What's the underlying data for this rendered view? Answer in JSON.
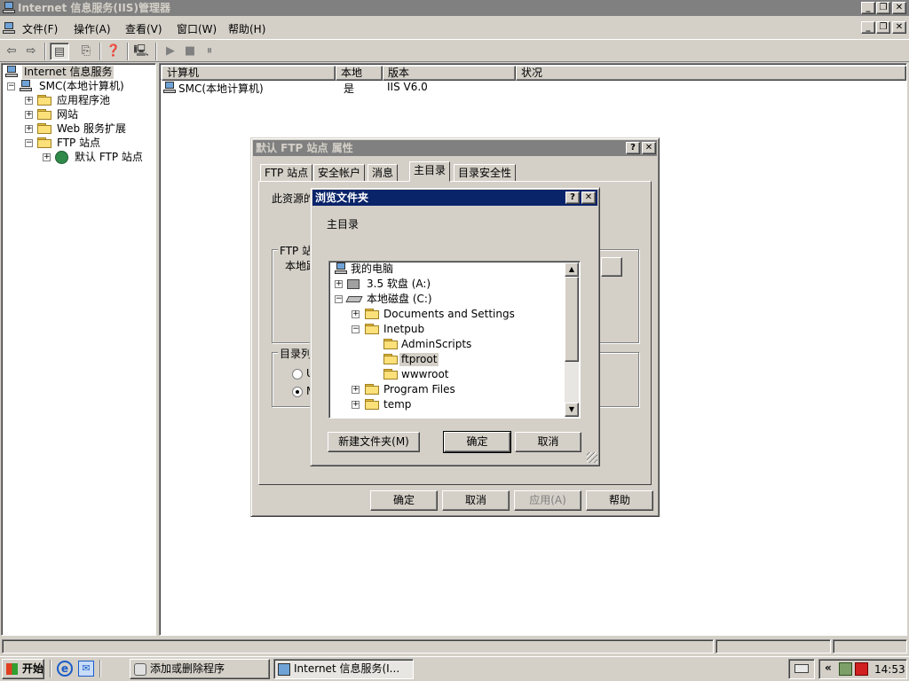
{
  "window": {
    "title": "Internet 信息服务(IIS)管理器"
  },
  "menu": {
    "items": [
      "文件(F)",
      "操作(A)",
      "查看(V)",
      "窗口(W)",
      "帮助(H)"
    ]
  },
  "tree": {
    "root": "Internet 信息服务",
    "computer": "SMC(本地计算机)",
    "items": [
      "应用程序池",
      "网站",
      "Web 服务扩展",
      "FTP 站点"
    ],
    "ftp_child": "默认 FTP 站点"
  },
  "list": {
    "columns": [
      "计算机",
      "本地",
      "版本",
      "状况"
    ],
    "rows": [
      {
        "computer": "SMC(本地计算机)",
        "local": "是",
        "version": "IIS V6.0",
        "status": ""
      }
    ]
  },
  "properties_dialog": {
    "title": "默认 FTP 站点 属性",
    "tabs": [
      "FTP 站点",
      "安全帐户",
      "消息",
      "主目录",
      "目录安全性"
    ],
    "active_tab": "主目录",
    "content_label_partial": "此资源的",
    "group_ftp_partial": "FTP 站",
    "local_path_partial": "本地路",
    "group_listing_partial": "目录列",
    "radio_u_partial": "U",
    "radio_m_partial": "M",
    "buttons": {
      "ok": "确定",
      "cancel": "取消",
      "apply": "应用(A)",
      "help": "帮助"
    }
  },
  "browse_dialog": {
    "title": "浏览文件夹",
    "description": "主目录",
    "tree": {
      "root": "我的电脑",
      "floppy": "3.5 软盘 (A:)",
      "local_disk": "本地磁盘 (C:)",
      "folders": [
        "Documents and Settings",
        "Inetpub"
      ],
      "inetpub_children": [
        "AdminScripts",
        "ftproot",
        "wwwroot"
      ],
      "more_folders": [
        "Program Files",
        "temp"
      ],
      "selected": "ftproot"
    },
    "buttons": {
      "new_folder": "新建文件夹(M)",
      "ok": "确定",
      "cancel": "取消"
    }
  },
  "taskbar": {
    "start": "开始",
    "tasks": [
      "添加或删除程序",
      "Internet 信息服务(I..."
    ],
    "chevron": "«",
    "clock": "14:53"
  }
}
